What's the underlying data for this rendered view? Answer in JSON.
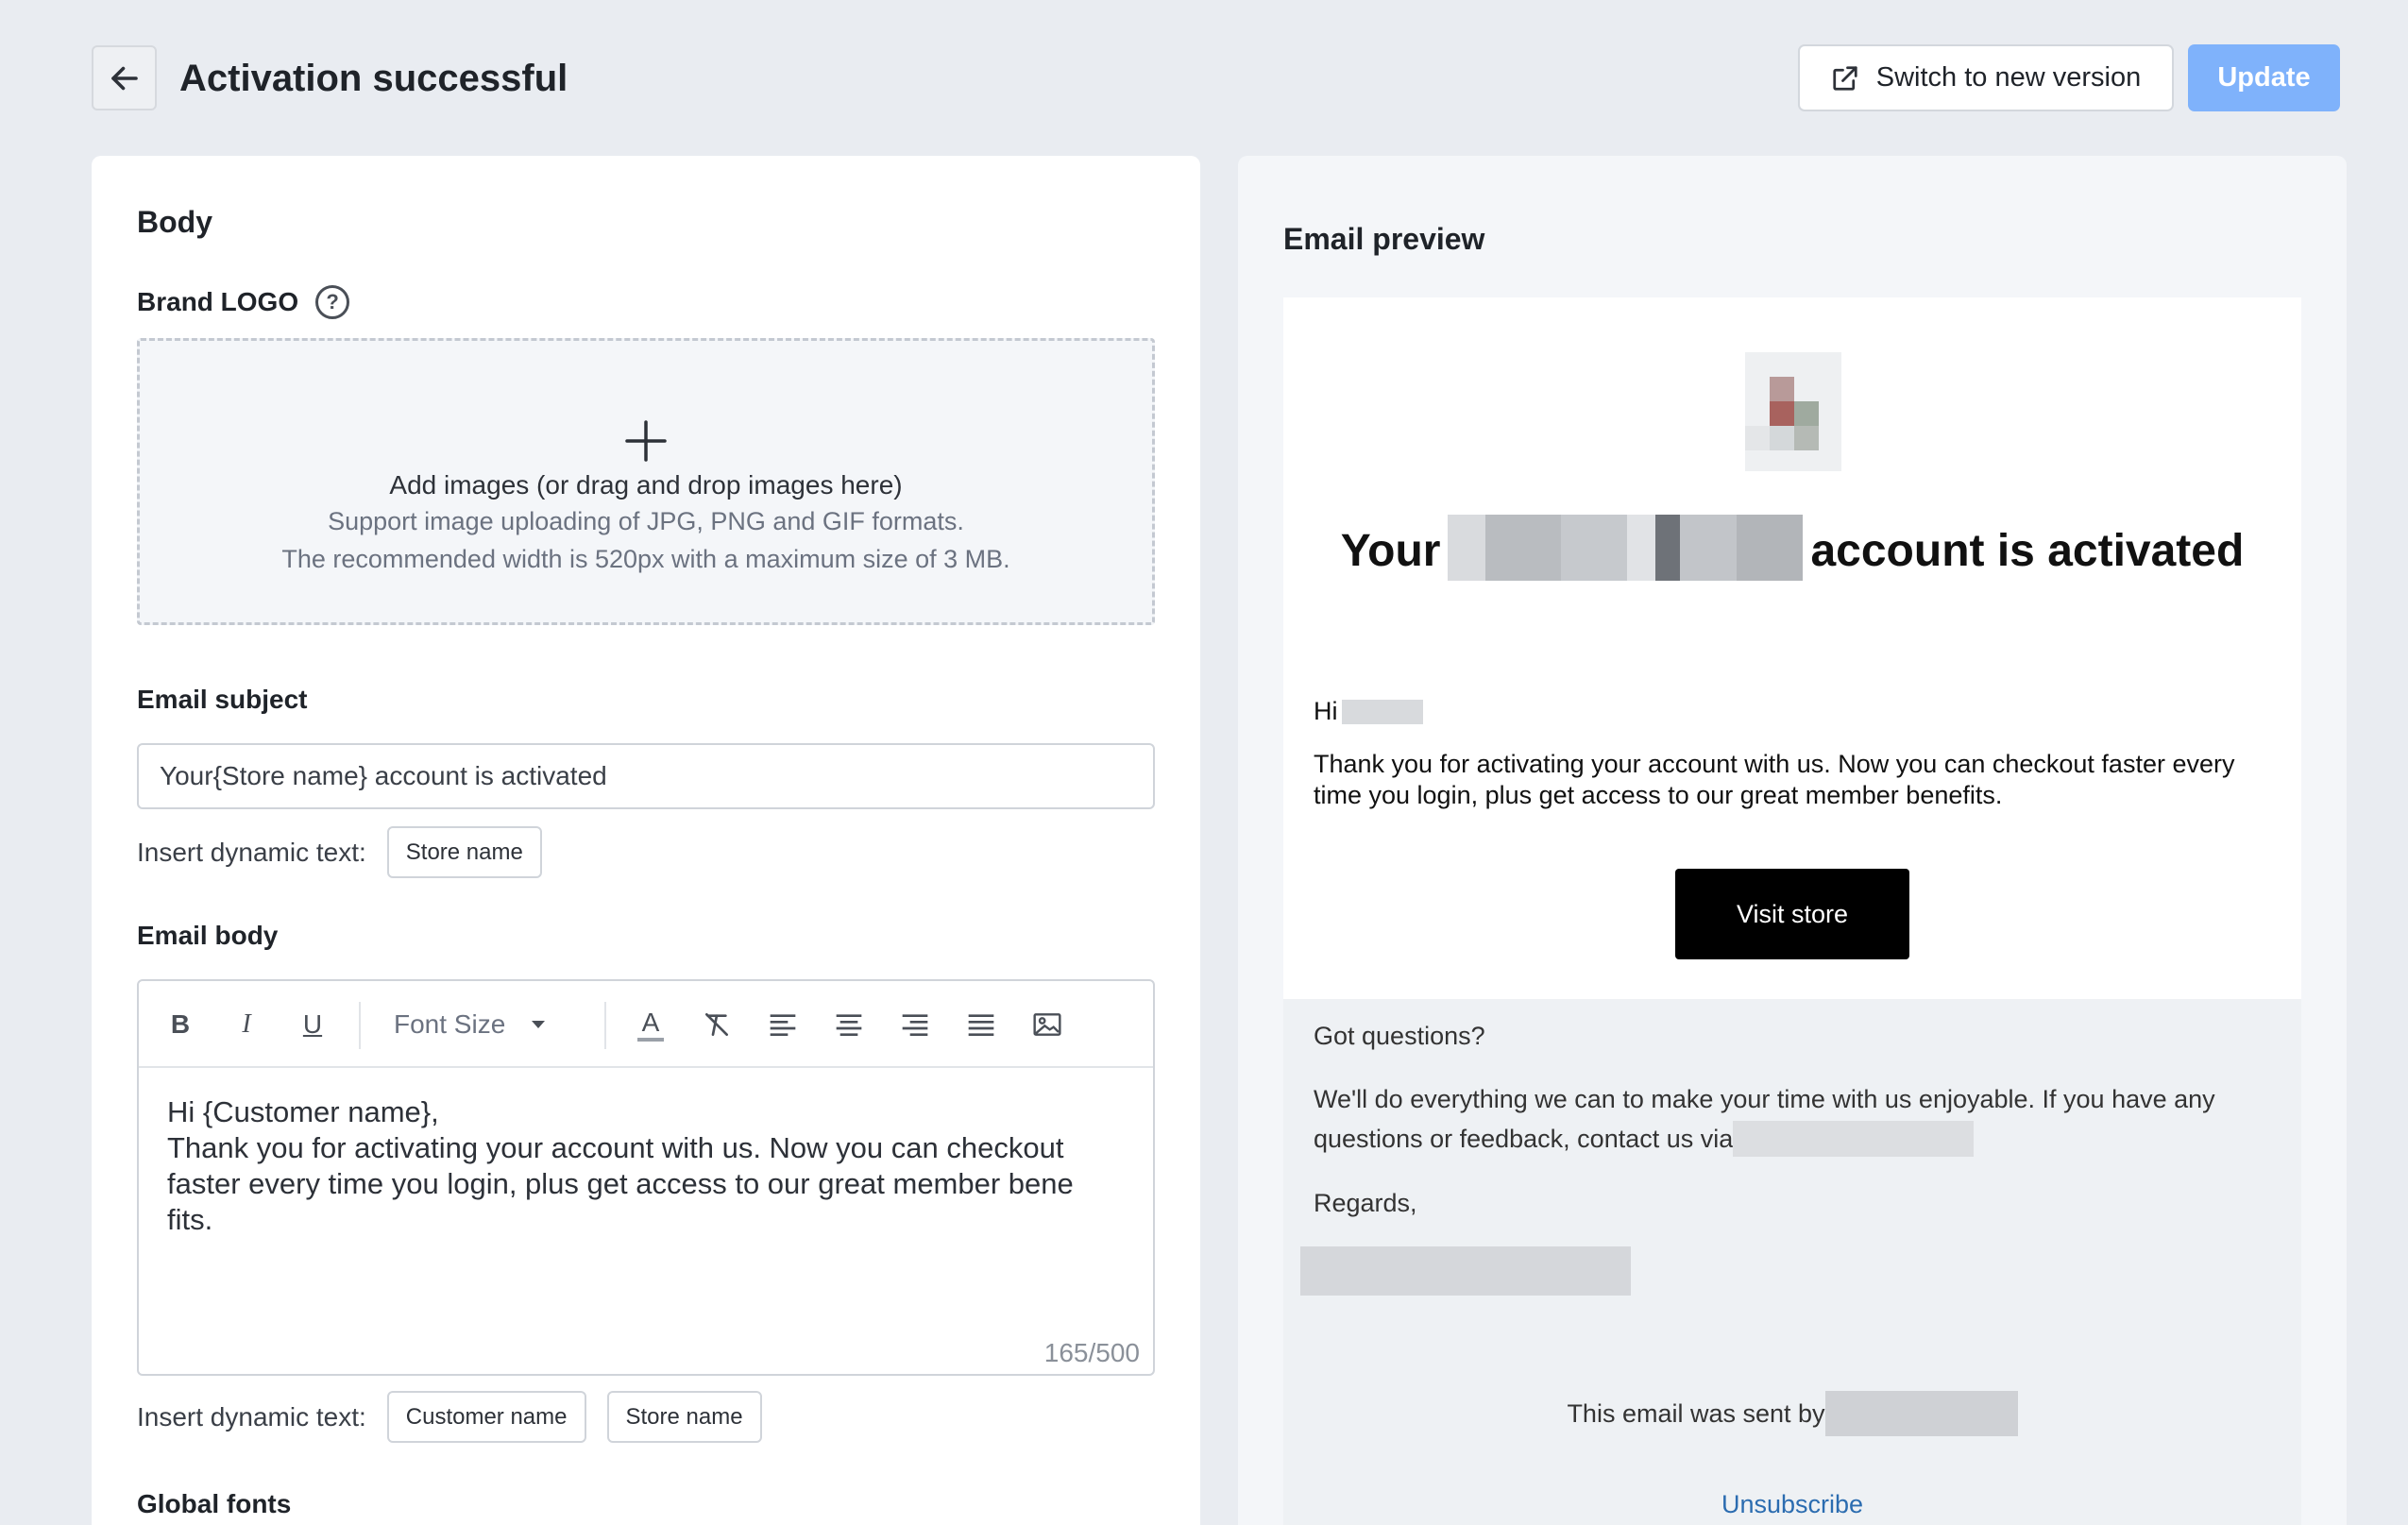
{
  "header": {
    "title": "Activation successful",
    "switch_label": "Switch to new version",
    "update_label": "Update"
  },
  "left": {
    "section_title": "Body",
    "brand_logo_label": "Brand LOGO",
    "upload": {
      "main": "Add images (or drag and drop images here)",
      "hint1": "Support image uploading of JPG, PNG and GIF formats.",
      "hint2": "The recommended width is 520px with a maximum size of 3 MB."
    },
    "subject": {
      "label": "Email subject",
      "value": "Your{Store name} account is activated",
      "dyn_label": "Insert dynamic text:",
      "chips": [
        "Store name"
      ]
    },
    "body": {
      "label": "Email body",
      "font_size_label": "Font Size",
      "text": "Hi {Customer name},\nThank you for activating your account with us. Now you can checkout\nfaster every time you login, plus get access to our great member bene\nfits.",
      "char_count": "165/500",
      "dyn_label": "Insert dynamic text:",
      "chips": [
        "Customer name",
        "Store name"
      ]
    },
    "global_fonts_label": "Global fonts"
  },
  "preview": {
    "title": "Email preview",
    "heading_prefix": "Your",
    "heading_suffix": "account is activated",
    "greeting": "Hi",
    "body_line1": "Thank you for activating your account with us. Now you can checkout faster every",
    "body_line2": "time you login, plus get access to our great member benefits.",
    "button_label": "Visit store",
    "questions": "Got questions?",
    "footer_line1": "We'll do everything we can to make your time with us enjoyable. If you have any",
    "footer_line2": "questions or feedback, contact us via",
    "regards": "Regards,",
    "sent_by": "This email was sent by",
    "unsubscribe": "Unsubscribe"
  },
  "colors": {
    "primary_button": "#7fb2fb",
    "cta_button": "#000000",
    "link": "#2b6cb0"
  }
}
